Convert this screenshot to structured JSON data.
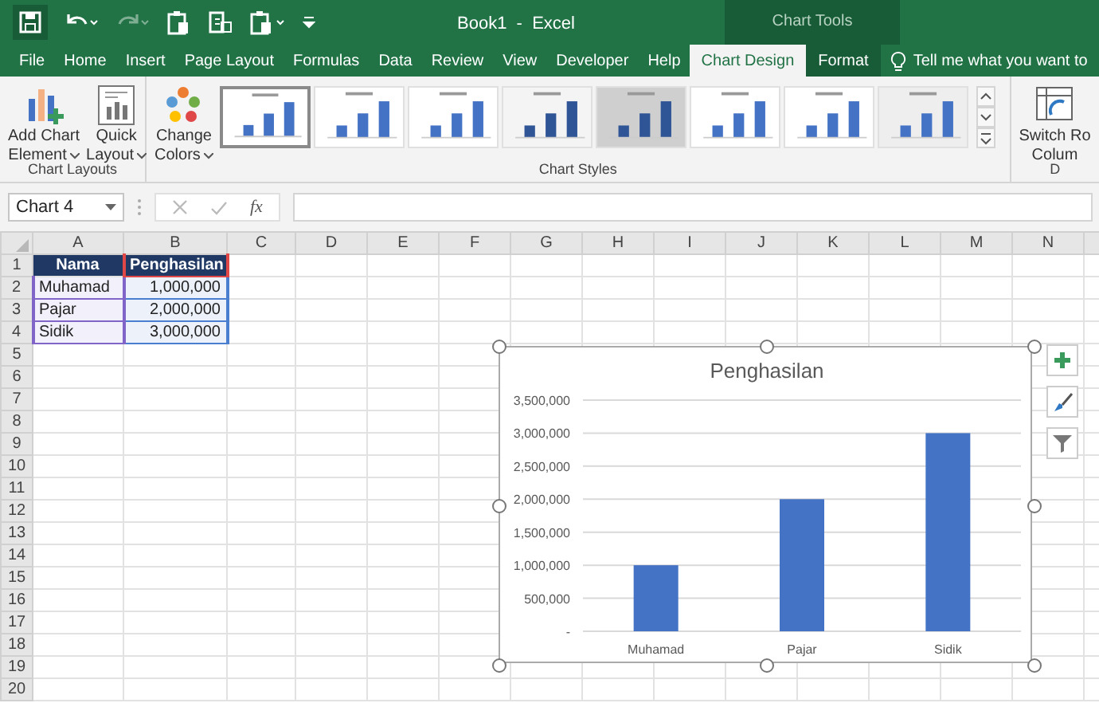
{
  "title_bar": {
    "title": "Book1  -  Excel",
    "context_label": "Chart Tools"
  },
  "tabs": [
    {
      "label": "File",
      "selected": false,
      "contextual": false
    },
    {
      "label": "Home",
      "selected": false,
      "contextual": false
    },
    {
      "label": "Insert",
      "selected": false,
      "contextual": false
    },
    {
      "label": "Page Layout",
      "selected": false,
      "contextual": false
    },
    {
      "label": "Formulas",
      "selected": false,
      "contextual": false
    },
    {
      "label": "Data",
      "selected": false,
      "contextual": false
    },
    {
      "label": "Review",
      "selected": false,
      "contextual": false
    },
    {
      "label": "View",
      "selected": false,
      "contextual": false
    },
    {
      "label": "Developer",
      "selected": false,
      "contextual": false
    },
    {
      "label": "Help",
      "selected": false,
      "contextual": false
    },
    {
      "label": "Chart Design",
      "selected": true,
      "contextual": true
    },
    {
      "label": "Format",
      "selected": false,
      "contextual": true
    }
  ],
  "tell_me": "Tell me what you want to",
  "ribbon": {
    "chart_layouts": {
      "label": "Chart Layouts",
      "buttons": [
        {
          "lines": [
            "Add Chart",
            "Element"
          ],
          "dropdown": true
        },
        {
          "lines": [
            "Quick",
            "Layout"
          ],
          "dropdown": true
        }
      ]
    },
    "chart_styles": {
      "label": "Chart Styles",
      "change_colors": {
        "lines": [
          "Change",
          "Colors"
        ],
        "dropdown": true
      },
      "styles": [
        {
          "selected": true
        },
        {
          "selected": false
        },
        {
          "selected": false
        },
        {
          "selected": false
        },
        {
          "selected": false
        },
        {
          "selected": false
        },
        {
          "selected": false
        },
        {
          "selected": false
        }
      ]
    },
    "data": {
      "label": "D",
      "switch": {
        "lines": [
          "Switch Ro",
          "Colum"
        ]
      }
    }
  },
  "formula_bar": {
    "name_box": "Chart 4",
    "function_label": "fx"
  },
  "columns": [
    "A",
    "B",
    "C",
    "D",
    "E",
    "F",
    "G",
    "H",
    "I",
    "J",
    "K",
    "L",
    "M",
    "N"
  ],
  "rows": [
    {
      "number": "1",
      "cells": [
        {
          "text": "Nama",
          "kind": "header"
        },
        {
          "text": "Penghasilan",
          "kind": "header",
          "color": "#e04848"
        }
      ]
    },
    {
      "number": "2",
      "cells": [
        {
          "text": "Muhamad",
          "kind": "text",
          "color": "#8064c8"
        },
        {
          "text": "1,000,000",
          "kind": "number",
          "color": "#4a7fd0"
        }
      ]
    },
    {
      "number": "3",
      "cells": [
        {
          "text": "Pajar",
          "kind": "text",
          "color": "#8064c8"
        },
        {
          "text": "2,000,000",
          "kind": "number",
          "color": "#4a7fd0"
        }
      ]
    },
    {
      "number": "4",
      "cells": [
        {
          "text": "Sidik",
          "kind": "text",
          "color": "#8064c8"
        },
        {
          "text": "3,000,000",
          "kind": "number",
          "color": "#4a7fd0"
        }
      ]
    },
    {
      "number": "5"
    },
    {
      "number": "6"
    },
    {
      "number": "7"
    },
    {
      "number": "8"
    },
    {
      "number": "9"
    },
    {
      "number": "10"
    },
    {
      "number": "11"
    },
    {
      "number": "12"
    },
    {
      "number": "13"
    },
    {
      "number": "14"
    },
    {
      "number": "15"
    },
    {
      "number": "16"
    },
    {
      "number": "17"
    },
    {
      "number": "18"
    },
    {
      "number": "19"
    },
    {
      "number": "20"
    }
  ],
  "chart": {
    "chart_data": {
      "type": "bar",
      "title": "Penghasilan",
      "categories": [
        "Muhamad",
        "Pajar",
        "Sidik"
      ],
      "series": [
        {
          "color": "#4472c4",
          "values": [
            1000000,
            2000000,
            3000000
          ]
        }
      ],
      "grid": true,
      "ylim": [
        0,
        3500000
      ],
      "yticks": [
        {
          "value": 0,
          "label": "-"
        },
        {
          "value": 500000,
          "label": "500,000"
        },
        {
          "value": 1000000,
          "label": "1,000,000"
        },
        {
          "value": 1500000,
          "label": "1,500,000"
        },
        {
          "value": 2000000,
          "label": "2,000,000"
        },
        {
          "value": 2500000,
          "label": "2,500,000"
        },
        {
          "value": 3000000,
          "label": "3,000,000"
        },
        {
          "value": 3500000,
          "label": "3,500,000"
        }
      ]
    }
  }
}
